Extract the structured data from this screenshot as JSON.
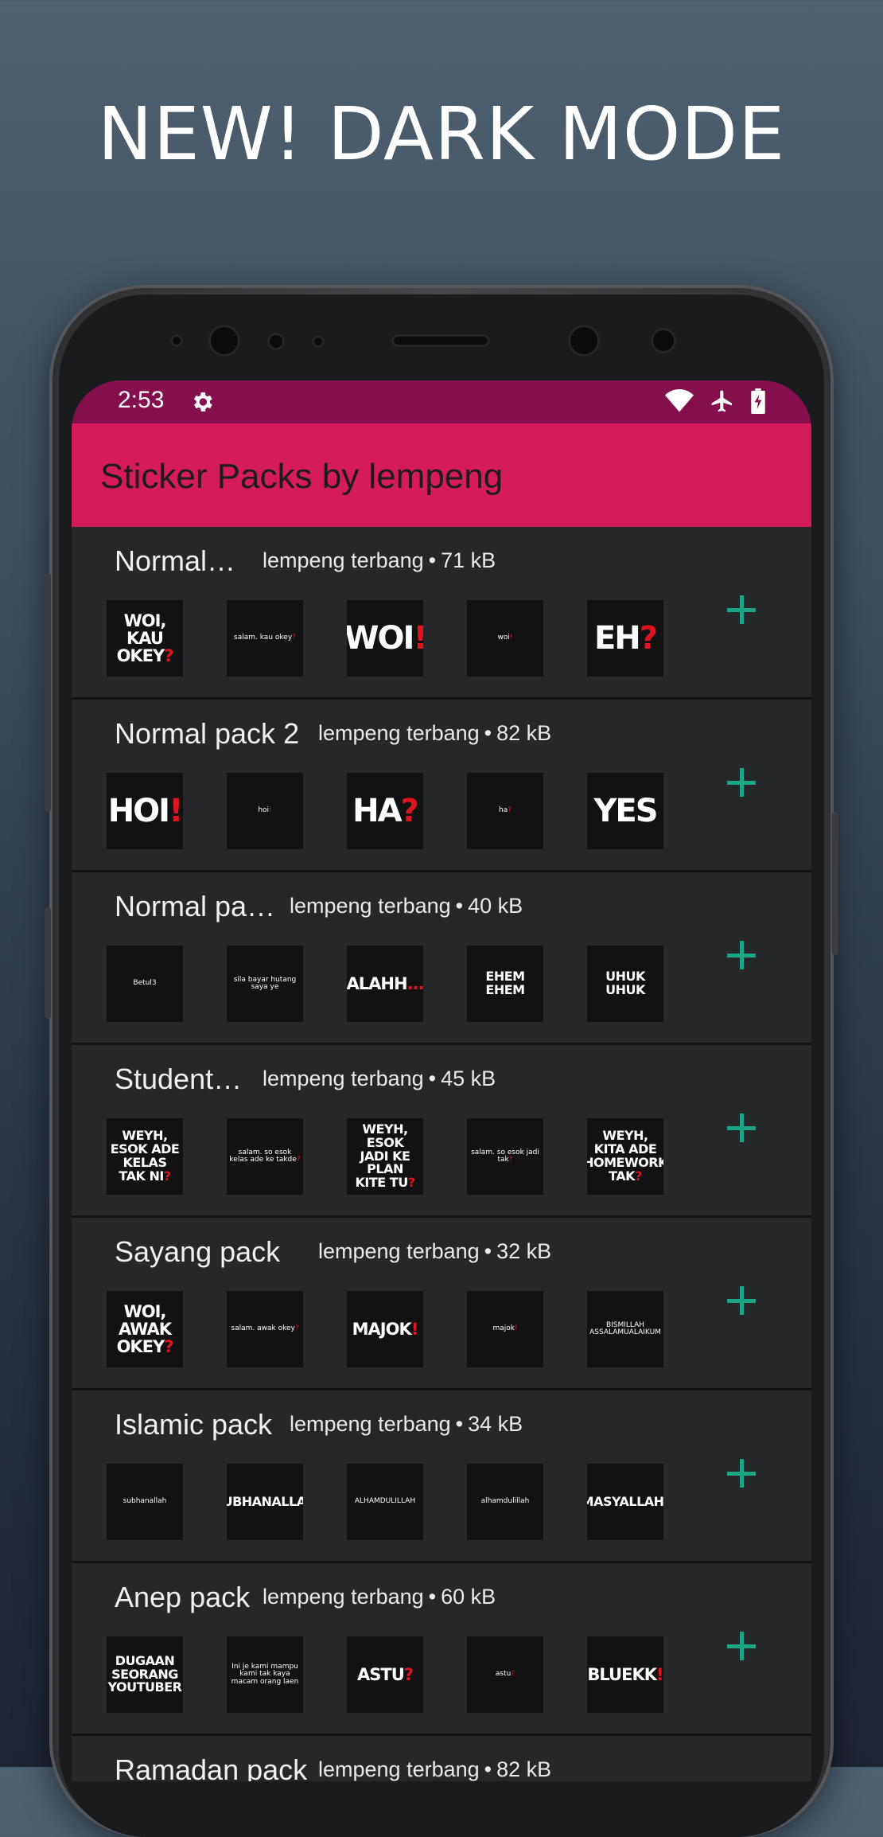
{
  "promo": {
    "title": "NEW! DARK MODE"
  },
  "status_bar": {
    "time": "2:53"
  },
  "app_bar": {
    "title": "Sticker Packs by lempeng"
  },
  "colors": {
    "accent": "#d61b5d",
    "status_bar": "#840f4d",
    "add": "#1aa585",
    "highlight": "#e0141e"
  },
  "packs": [
    {
      "name": "Normal…",
      "publisher": "lempeng terbang",
      "size": "71 kB",
      "stickers": [
        [
          "WOI,",
          "KAU",
          "OKEY",
          "?"
        ],
        [
          "salam. kau okey",
          "?"
        ],
        [
          "WOI",
          "!"
        ],
        [
          "woi",
          "!"
        ],
        [
          "EH",
          "?"
        ]
      ]
    },
    {
      "name": "Normal pack 2",
      "publisher": "lempeng terbang",
      "size": "82 kB",
      "stickers": [
        [
          "HOI",
          "!"
        ],
        [
          "hoi",
          "!"
        ],
        [
          "HA",
          "?"
        ],
        [
          "ha",
          "?"
        ],
        [
          "YES"
        ]
      ]
    },
    {
      "name": "Normal pa…",
      "publisher": "lempeng terbang",
      "size": "40 kB",
      "stickers": [
        [
          "Betul3"
        ],
        [
          "sila bayar hutang saya ye"
        ],
        [
          "ALAHH",
          "..."
        ],
        [
          "EHEM EHEM"
        ],
        [
          "UHUK UHUK"
        ]
      ]
    },
    {
      "name": "Student…",
      "publisher": "lempeng terbang",
      "size": "45 kB",
      "stickers": [
        [
          "WEYH,",
          "ESOK ADE",
          "KELAS",
          "TAK NI",
          "?"
        ],
        [
          "salam. so esok kelas ade ke takde",
          "?"
        ],
        [
          "WEYH,",
          "ESOK",
          "JADI KE",
          "PLAN",
          "KITE TU",
          "?"
        ],
        [
          "salam. so esok jadi tak",
          "?"
        ],
        [
          "WEYH,",
          "KITA ADE",
          "HOMEWORK",
          "TAK",
          "?"
        ]
      ]
    },
    {
      "name": "Sayang pack",
      "publisher": "lempeng terbang",
      "size": "32 kB",
      "stickers": [
        [
          "WOI,",
          "AWAK",
          "OKEY",
          "?"
        ],
        [
          "salam. awak okey",
          "?"
        ],
        [
          "MAJOK",
          "!"
        ],
        [
          "majok",
          "!"
        ],
        [
          "BISMILLAH",
          "ASSALAMUALAIKUM"
        ]
      ]
    },
    {
      "name": "Islamic pack",
      "publisher": "lempeng terbang",
      "size": "34 kB",
      "stickers": [
        [
          "subhanallah"
        ],
        [
          "SUBHANALLAH"
        ],
        [
          "ALHAMDULILLAH"
        ],
        [
          "alhamdulillah"
        ],
        [
          "MASYALLAH",
          "!"
        ]
      ]
    },
    {
      "name": "Anep pack",
      "publisher": "lempeng terbang",
      "size": "60 kB",
      "stickers": [
        [
          "DUGAAN",
          "SEORANG",
          "YOUTUBER"
        ],
        [
          "Ini je kami mampu kami tak kaya macam orang laen"
        ],
        [
          "ASTU",
          "?"
        ],
        [
          "astu",
          "?"
        ],
        [
          "BLUEKK",
          "!"
        ]
      ]
    },
    {
      "name": "Ramadan pack",
      "publisher": "lempeng terbang",
      "size": "82 kB",
      "stickers": [
        [
          "..."
        ],
        [
          "..."
        ],
        [
          "..."
        ],
        [
          "..."
        ],
        [
          "..."
        ]
      ]
    }
  ]
}
